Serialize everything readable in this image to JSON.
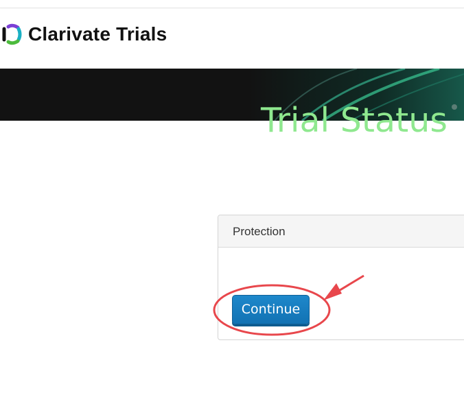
{
  "header": {
    "brand": "Clarivate Trials",
    "logo_icon": "clarivate-logo-icon"
  },
  "banner": {
    "title": "Trial Status"
  },
  "panel": {
    "heading": "Protection",
    "continue_label": "Continue"
  },
  "colors": {
    "banner_title": "#8fe88f",
    "button": "#1a7ec4",
    "annotation": "#e8474c"
  }
}
